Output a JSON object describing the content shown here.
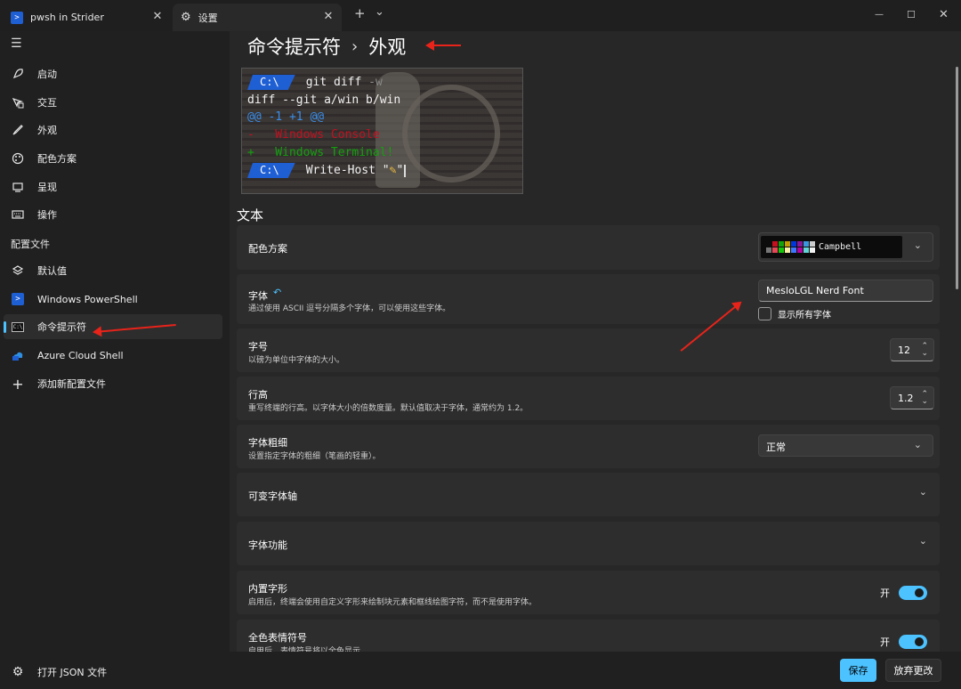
{
  "window": {
    "tabs": [
      {
        "label": "pwsh in Strider"
      },
      {
        "label": "设置"
      }
    ],
    "new_tab_glyph": "+",
    "dropdown_glyph": "⌄",
    "min_glyph": "—",
    "max_glyph": "☐",
    "close_glyph": "✕"
  },
  "sidebar": {
    "menu_glyph": "☰",
    "items": [
      {
        "label": "启动",
        "icon": "rocket-icon"
      },
      {
        "label": "交互",
        "icon": "interaction-icon"
      },
      {
        "label": "外观",
        "icon": "brush-icon"
      },
      {
        "label": "配色方案",
        "icon": "palette-icon"
      },
      {
        "label": "呈现",
        "icon": "monitor-icon"
      },
      {
        "label": "操作",
        "icon": "keyboard-icon"
      }
    ],
    "profiles_label": "配置文件",
    "profiles": [
      {
        "label": "默认值",
        "icon": "layers-icon"
      },
      {
        "label": "Windows PowerShell",
        "icon": "powershell-icon"
      },
      {
        "label": "命令提示符",
        "icon": "cmd-icon",
        "active": true
      },
      {
        "label": "Azure Cloud Shell",
        "icon": "azure-icon"
      },
      {
        "label": "添加新配置文件",
        "icon": "plus-icon"
      }
    ],
    "open_json": "打开 JSON 文件"
  },
  "main": {
    "breadcrumb": [
      "命令提示符",
      "外观"
    ],
    "breadcrumb_sep": "›",
    "preview": {
      "prompt": "C:\\",
      "lines": [
        {
          "text": "git diff ",
          "suffix": "-w"
        },
        {
          "text": "diff --git a/win b/win"
        },
        {
          "text": "@@ -1 +1 @@"
        },
        {
          "text": "-   Windows Console"
        },
        {
          "text": "+   Windows Terminal!"
        },
        {
          "text": "Write-Host \"",
          "emoji": "✎",
          "suffix": "\""
        }
      ]
    },
    "section_text": "文本",
    "rows": {
      "color_scheme": {
        "title": "配色方案",
        "value": "Campbell"
      },
      "font_face": {
        "title": "字体",
        "reset_glyph": "↶",
        "desc": "通过使用 ASCII 逗号分隔多个字体，可以使用这些字体。",
        "value": "MesloLGL Nerd Font",
        "checkbox_label": "显示所有字体"
      },
      "font_size": {
        "title": "字号",
        "desc": "以磅为单位中字体的大小。",
        "value": "12"
      },
      "line_height": {
        "title": "行高",
        "desc": "重写终端的行高。以字体大小的倍数度量。默认值取决于字体，通常约为 1.2。",
        "value": "1.2"
      },
      "font_weight": {
        "title": "字体粗细",
        "desc": "设置指定字体的粗细（笔画的轻重）。",
        "value": "正常"
      },
      "variable_axes": {
        "title": "可变字体轴"
      },
      "font_features": {
        "title": "字体功能"
      },
      "builtin_glyphs": {
        "title": "内置字形",
        "desc": "启用后，终端会使用自定义字形来绘制块元素和框线绘图字符，而不是使用字体。",
        "state": "开"
      },
      "color_emoji": {
        "title": "全色表情符号",
        "desc": "启用后，表情符号将以全色显示。",
        "state": "开"
      }
    },
    "chevron_glyph": "⌄",
    "stepper_glyph": "⌃⌄"
  },
  "footer": {
    "save": "保存",
    "discard": "放弃更改"
  },
  "colors": {
    "accent": "#4cc2ff",
    "annotation_arrow": "#e8231a",
    "prompt_blue": "#1f5fd4",
    "diff_header": "#3b8eea",
    "diff_removed": "#c50f1f",
    "diff_added": "#13a10e"
  }
}
